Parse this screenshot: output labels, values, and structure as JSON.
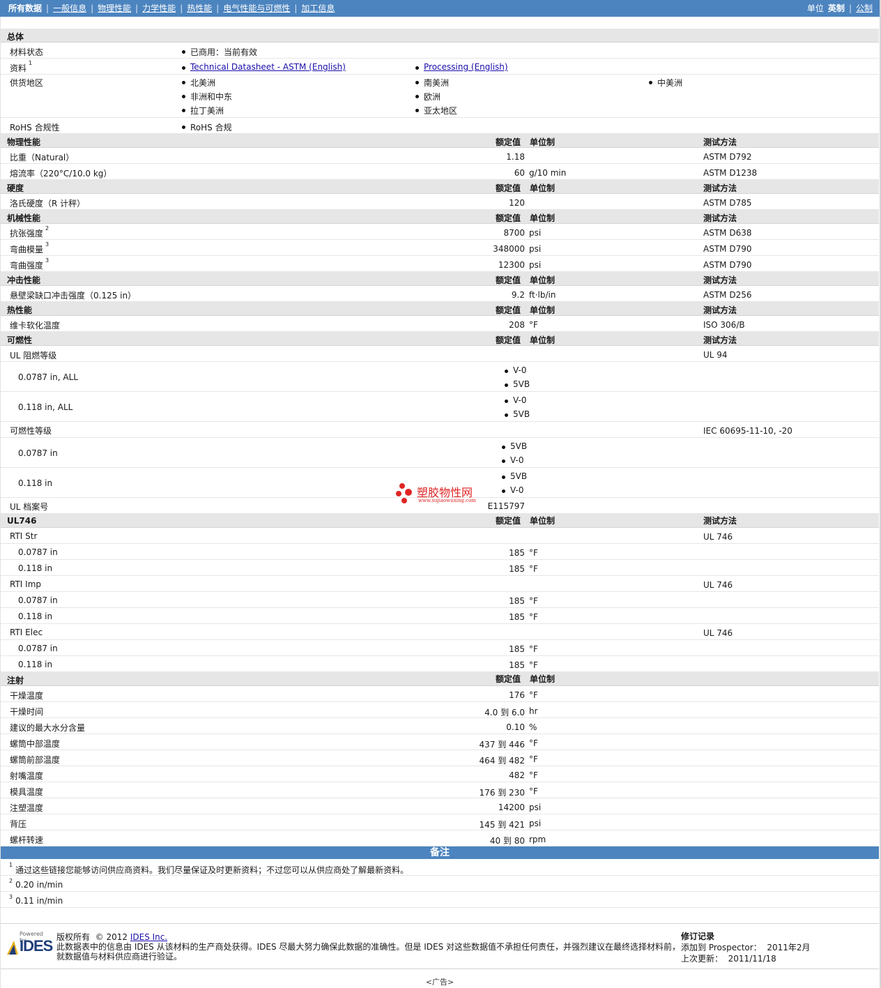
{
  "nav": {
    "items": [
      "所有数据",
      "一般信息",
      "物理性能",
      "力学性能",
      "热性能",
      "电气性能与可燃性",
      "加工信息"
    ],
    "units_label": "单位",
    "unit_en": "英制",
    "unit_metric": "公制"
  },
  "headers": {
    "value": "额定值",
    "unit": "单位制",
    "method": "测试方法"
  },
  "general": {
    "title": "总体",
    "status_label": "材料状态",
    "status_value": "已商用：当前有效",
    "docs_label": "资料",
    "docs_sup": "1",
    "doc1": "Technical Datasheet - ASTM (English)",
    "doc2": "Processing (English)",
    "supply_label": "供货地区",
    "regions": [
      "北美洲",
      "南美洲",
      "中美洲",
      "非洲和中东",
      "欧洲",
      "拉丁美洲",
      "亚太地区"
    ],
    "rohs_label": "RoHS 合规性",
    "rohs_value": "RoHS 合规"
  },
  "physical": {
    "title": "物理性能",
    "rows": [
      {
        "label": "比重（Natural）",
        "value": "1.18",
        "unit": "",
        "method": "ASTM D792"
      },
      {
        "label": "熔流率（220°C/10.0 kg）",
        "value": "60",
        "unit": "g/10 min",
        "method": "ASTM D1238"
      }
    ]
  },
  "hardness": {
    "title": "硬度",
    "rows": [
      {
        "label": "洛氏硬度（R 计秤）",
        "value": "120",
        "unit": "",
        "method": "ASTM D785"
      }
    ]
  },
  "mechanical": {
    "title": "机械性能",
    "rows": [
      {
        "label": "抗张强度",
        "sup": "2",
        "value": "8700",
        "unit": "psi",
        "method": "ASTM D638"
      },
      {
        "label": "弯曲模量",
        "sup": "3",
        "value": "348000",
        "unit": "psi",
        "method": "ASTM D790"
      },
      {
        "label": "弯曲强度",
        "sup": "3",
        "value": "12300",
        "unit": "psi",
        "method": "ASTM D790"
      }
    ]
  },
  "impact": {
    "title": "冲击性能",
    "rows": [
      {
        "label": "悬壁梁缺口冲击强度（0.125 in）",
        "value": "9.2",
        "unit": "ft·lb/in",
        "method": "ASTM D256"
      }
    ]
  },
  "thermal": {
    "title": "热性能",
    "rows": [
      {
        "label": "维卡软化温度",
        "value": "208",
        "unit": "°F",
        "method": "ISO 306/B"
      }
    ]
  },
  "flammability": {
    "title": "可燃性",
    "ul_label": "UL 阻燃等级",
    "ul_method": "UL 94",
    "ul_a_label": "0.0787 in, ALL",
    "ul_a_vals": [
      "V-0",
      "5VB"
    ],
    "ul_b_label": "0.118 in, ALL",
    "ul_b_vals": [
      "V-0",
      "5VB"
    ],
    "iec_label": "可燃性等级",
    "iec_method": "IEC 60695-11-10, -20",
    "iec_a_label": "0.0787 in",
    "iec_a_vals": [
      "5VB",
      "V-0"
    ],
    "iec_b_label": "0.118 in",
    "iec_b_vals": [
      "5VB",
      "V-0"
    ],
    "file_label": "UL 档案号",
    "file_value": "E115797"
  },
  "ul746": {
    "title": "UL746",
    "groups": [
      {
        "label": "RTI Str",
        "method": "UL 746",
        "rows": [
          {
            "label": "0.0787 in",
            "value": "185",
            "unit": "°F"
          },
          {
            "label": "0.118 in",
            "value": "185",
            "unit": "°F"
          }
        ]
      },
      {
        "label": "RTI Imp",
        "method": "UL 746",
        "rows": [
          {
            "label": "0.0787 in",
            "value": "185",
            "unit": "°F"
          },
          {
            "label": "0.118 in",
            "value": "185",
            "unit": "°F"
          }
        ]
      },
      {
        "label": "RTI Elec",
        "method": "UL 746",
        "rows": [
          {
            "label": "0.0787 in",
            "value": "185",
            "unit": "°F"
          },
          {
            "label": "0.118 in",
            "value": "185",
            "unit": "°F"
          }
        ]
      }
    ]
  },
  "injection": {
    "title": "注射",
    "rows": [
      {
        "label": "干燥温度",
        "value": "176",
        "unit": "°F"
      },
      {
        "label": "干燥时间",
        "value": "4.0 到  6.0",
        "unit": "hr"
      },
      {
        "label": "建议的最大水分含量",
        "value": "0.10",
        "unit": "%"
      },
      {
        "label": "螺筒中部温度",
        "value": "437 到  446",
        "unit": "°F"
      },
      {
        "label": "螺筒前部温度",
        "value": "464 到  482",
        "unit": "°F"
      },
      {
        "label": "射嘴温度",
        "value": "482",
        "unit": "°F"
      },
      {
        "label": "模具温度",
        "value": "176 到  230",
        "unit": "°F"
      },
      {
        "label": "注塑温度",
        "value": "14200",
        "unit": "psi"
      },
      {
        "label": "背压",
        "value": "145 到  421",
        "unit": "psi"
      },
      {
        "label": "螺杆转速",
        "value": "40 到  80",
        "unit": "rpm"
      }
    ]
  },
  "notes": {
    "title": "备注",
    "items": [
      {
        "sup": "1",
        "text": "通过这些链接您能够访问供应商资料。我们尽量保证及时更新资料；不过您可以从供应商处了解最新资料。"
      },
      {
        "sup": "2",
        "text": "0.20 in/min"
      },
      {
        "sup": "3",
        "text": "0.11 in/min"
      }
    ]
  },
  "footer": {
    "powered_by": "Powered by",
    "logo_text": "IDES",
    "copyright_label": "版权所有",
    "copyright_year": "© 2012",
    "company": "IDES Inc.",
    "disclaimer1": "此数据表中的信息由 IDES 从该材料的生产商处获得。IDES 尽最大努力确保此数据的准确性。但是 IDES 对这些数据值不承担任何责任，并强烈建议在最终选择材料前，",
    "disclaimer2": "就数据值与材料供应商进行验证。",
    "rev_title": "修订记录",
    "added_label": "添加到 Prospector：",
    "added_value": "2011年2月",
    "updated_label": "上次更新：",
    "updated_value": "2011/11/18",
    "ad": "<广告>"
  },
  "watermark": {
    "text": "塑胶物性网",
    "url": "www.sujiaowuxing.com"
  }
}
